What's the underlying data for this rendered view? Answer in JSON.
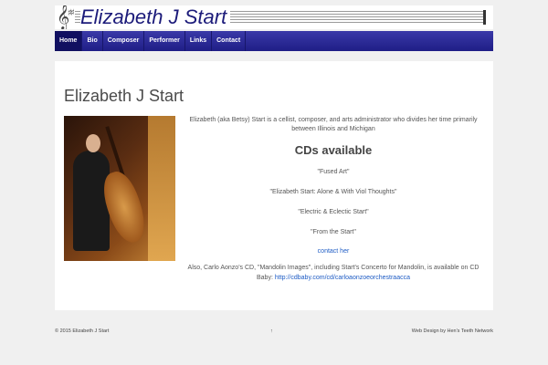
{
  "header": {
    "site_title": "Elizabeth J Start",
    "clef_glyph": "𝄞",
    "sharps_glyph": "♯♯"
  },
  "nav": {
    "items": [
      {
        "label": "Home",
        "active": true
      },
      {
        "label": "Bio"
      },
      {
        "label": "Composer"
      },
      {
        "label": "Performer"
      },
      {
        "label": "Links"
      },
      {
        "label": "Contact"
      }
    ]
  },
  "main": {
    "title": "Elizabeth J Start",
    "intro": "Elizabeth (aka Betsy) Start is a cellist, composer, and arts administrator who divides her time primarily between Illinois and Michigan",
    "cds_heading": "CDs available",
    "cds": [
      "\"Fused Art\"",
      "\"Elizabeth Start: Alone & With Viol Thoughts\"",
      "\"Electric & Eclectic Start\"",
      "\"From the Start\""
    ],
    "contact_link": "contact her",
    "also_text": "Also, Carlo Aonzo's CD, \"Mandolin Images\", including Start's Concerto for Mandolin, is available on CD Baby: ",
    "also_link": "http://cdbaby.com/cd/carloaonzoeorchestraacca"
  },
  "footer": {
    "copyright": "© 2015 Elizabeth J Start",
    "back_to_top": "↑",
    "credit": "Web Design by Hen's Teeth Network"
  }
}
